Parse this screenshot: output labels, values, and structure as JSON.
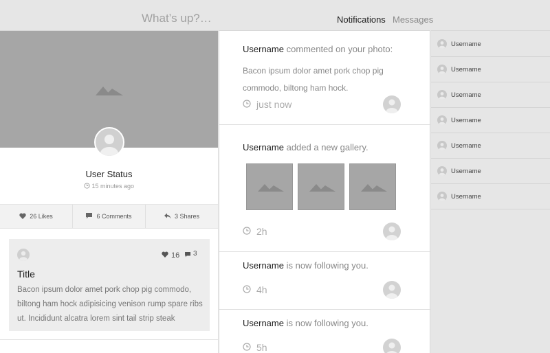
{
  "header": {
    "compose_placeholder": "What’s up?…",
    "nav": {
      "notifications": "Notifications",
      "messages": "Messages"
    }
  },
  "profile": {
    "status": "User Status",
    "time": "15 minutes ago",
    "stats": {
      "likes": "26 Likes",
      "comments": "6 Comments",
      "shares": "3 Shares"
    }
  },
  "post": {
    "likes": "16",
    "comments": "3",
    "title": "Title",
    "body": "Bacon ipsum dolor amet pork chop pig commodo, biltong ham hock adipisicing venison rump spare ribs ut. Incididunt alcatra lorem sint tail strip steak"
  },
  "notifications": [
    {
      "user": "Username",
      "action": "commented on your photo:",
      "body": "Bacon ipsum dolor amet pork chop pig commodo, biltong ham hock.",
      "time": "just now"
    },
    {
      "user": "Username",
      "action": "added a new gallery.",
      "time": "2h"
    },
    {
      "user": "Username",
      "action": "is now following you.",
      "time": "4h"
    },
    {
      "user": "Username",
      "action": "is now following you.",
      "time": "5h"
    }
  ],
  "users": [
    "Username",
    "Username",
    "Username",
    "Username",
    "Username",
    "Username",
    "Username"
  ]
}
